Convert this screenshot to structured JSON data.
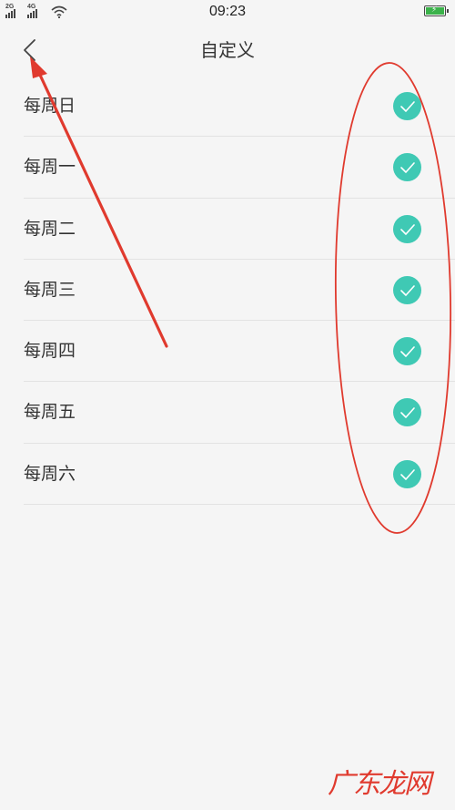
{
  "status_bar": {
    "network_1": "2G",
    "network_2": "4G",
    "time": "09:23",
    "icons": [
      "signal-icon",
      "signal-icon",
      "wifi-icon",
      "battery-charging-icon"
    ]
  },
  "header": {
    "title": "自定义",
    "back_icon": "chevron-left-icon"
  },
  "days": [
    {
      "label": "每周日",
      "checked": true
    },
    {
      "label": "每周一",
      "checked": true
    },
    {
      "label": "每周二",
      "checked": true
    },
    {
      "label": "每周三",
      "checked": true
    },
    {
      "label": "每周四",
      "checked": true
    },
    {
      "label": "每周五",
      "checked": true
    },
    {
      "label": "每周六",
      "checked": true
    }
  ],
  "colors": {
    "check_accent": "#3fc9b4",
    "annotation_red": "#e03a2e",
    "background": "#f5f5f5"
  },
  "watermark": "广东龙网"
}
